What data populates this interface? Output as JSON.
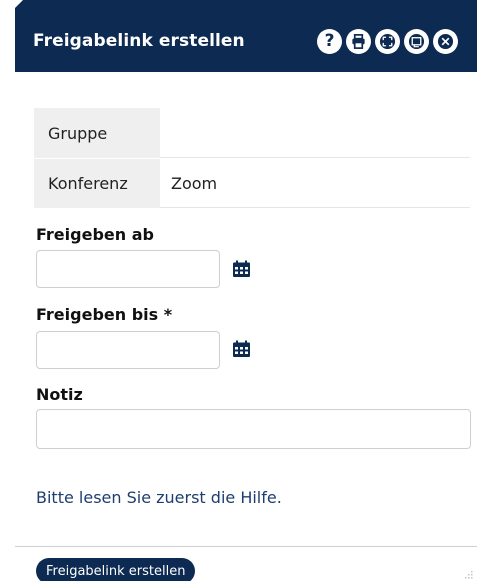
{
  "dialog": {
    "title": "Freigabelink erstellen",
    "help_glyph": "?"
  },
  "info": {
    "rows": [
      {
        "label": "Gruppe",
        "value": ""
      },
      {
        "label": "Konferenz",
        "value": "Zoom"
      }
    ]
  },
  "form": {
    "from_label": "Freigeben ab",
    "from_value": "",
    "until_label": "Freigeben bis *",
    "until_value": "",
    "note_label": "Notiz",
    "note_value": ""
  },
  "hint": "Bitte lesen Sie zuerst die Hilfe.",
  "footer": {
    "submit_label": "Freigabelink erstellen"
  },
  "colors": {
    "header_bg": "#0d2a52",
    "label_bg": "#efefef",
    "link": "#1d3e6e"
  },
  "icons": [
    "help-icon",
    "print-icon",
    "fullscreen-icon",
    "window-icon",
    "close-icon",
    "calendar-icon",
    "resize-grip-icon"
  ]
}
